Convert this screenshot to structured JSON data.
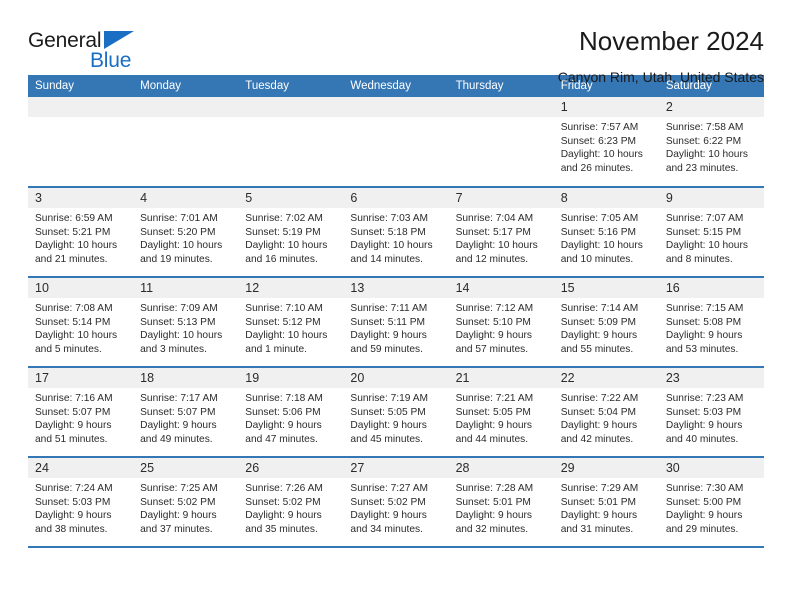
{
  "brand": {
    "word_one": "General",
    "word_two": "Blue",
    "logo_icon": "triangle-logo-icon",
    "accent_color": "#1a6fc4"
  },
  "header": {
    "title": "November 2024",
    "location": "Canyon Rim, Utah, United States"
  },
  "calendar": {
    "header_bg": "#3576b5",
    "daynum_bg": "#f0f0f0",
    "weekday_headers": [
      "Sunday",
      "Monday",
      "Tuesday",
      "Wednesday",
      "Thursday",
      "Friday",
      "Saturday"
    ],
    "labels": {
      "sunrise": "Sunrise:",
      "sunset": "Sunset:",
      "daylight": "Daylight:"
    },
    "weeks": [
      [
        {
          "day": "",
          "empty": true
        },
        {
          "day": "",
          "empty": true
        },
        {
          "day": "",
          "empty": true
        },
        {
          "day": "",
          "empty": true
        },
        {
          "day": "",
          "empty": true
        },
        {
          "day": "1",
          "sunrise": "Sunrise: 7:57 AM",
          "sunset": "Sunset: 6:23 PM",
          "daylight_line1": "Daylight: 10 hours",
          "daylight_line2": "and 26 minutes."
        },
        {
          "day": "2",
          "sunrise": "Sunrise: 7:58 AM",
          "sunset": "Sunset: 6:22 PM",
          "daylight_line1": "Daylight: 10 hours",
          "daylight_line2": "and 23 minutes."
        }
      ],
      [
        {
          "day": "3",
          "sunrise": "Sunrise: 6:59 AM",
          "sunset": "Sunset: 5:21 PM",
          "daylight_line1": "Daylight: 10 hours",
          "daylight_line2": "and 21 minutes."
        },
        {
          "day": "4",
          "sunrise": "Sunrise: 7:01 AM",
          "sunset": "Sunset: 5:20 PM",
          "daylight_line1": "Daylight: 10 hours",
          "daylight_line2": "and 19 minutes."
        },
        {
          "day": "5",
          "sunrise": "Sunrise: 7:02 AM",
          "sunset": "Sunset: 5:19 PM",
          "daylight_line1": "Daylight: 10 hours",
          "daylight_line2": "and 16 minutes."
        },
        {
          "day": "6",
          "sunrise": "Sunrise: 7:03 AM",
          "sunset": "Sunset: 5:18 PM",
          "daylight_line1": "Daylight: 10 hours",
          "daylight_line2": "and 14 minutes."
        },
        {
          "day": "7",
          "sunrise": "Sunrise: 7:04 AM",
          "sunset": "Sunset: 5:17 PM",
          "daylight_line1": "Daylight: 10 hours",
          "daylight_line2": "and 12 minutes."
        },
        {
          "day": "8",
          "sunrise": "Sunrise: 7:05 AM",
          "sunset": "Sunset: 5:16 PM",
          "daylight_line1": "Daylight: 10 hours",
          "daylight_line2": "and 10 minutes."
        },
        {
          "day": "9",
          "sunrise": "Sunrise: 7:07 AM",
          "sunset": "Sunset: 5:15 PM",
          "daylight_line1": "Daylight: 10 hours",
          "daylight_line2": "and 8 minutes."
        }
      ],
      [
        {
          "day": "10",
          "sunrise": "Sunrise: 7:08 AM",
          "sunset": "Sunset: 5:14 PM",
          "daylight_line1": "Daylight: 10 hours",
          "daylight_line2": "and 5 minutes."
        },
        {
          "day": "11",
          "sunrise": "Sunrise: 7:09 AM",
          "sunset": "Sunset: 5:13 PM",
          "daylight_line1": "Daylight: 10 hours",
          "daylight_line2": "and 3 minutes."
        },
        {
          "day": "12",
          "sunrise": "Sunrise: 7:10 AM",
          "sunset": "Sunset: 5:12 PM",
          "daylight_line1": "Daylight: 10 hours",
          "daylight_line2": "and 1 minute."
        },
        {
          "day": "13",
          "sunrise": "Sunrise: 7:11 AM",
          "sunset": "Sunset: 5:11 PM",
          "daylight_line1": "Daylight: 9 hours",
          "daylight_line2": "and 59 minutes."
        },
        {
          "day": "14",
          "sunrise": "Sunrise: 7:12 AM",
          "sunset": "Sunset: 5:10 PM",
          "daylight_line1": "Daylight: 9 hours",
          "daylight_line2": "and 57 minutes."
        },
        {
          "day": "15",
          "sunrise": "Sunrise: 7:14 AM",
          "sunset": "Sunset: 5:09 PM",
          "daylight_line1": "Daylight: 9 hours",
          "daylight_line2": "and 55 minutes."
        },
        {
          "day": "16",
          "sunrise": "Sunrise: 7:15 AM",
          "sunset": "Sunset: 5:08 PM",
          "daylight_line1": "Daylight: 9 hours",
          "daylight_line2": "and 53 minutes."
        }
      ],
      [
        {
          "day": "17",
          "sunrise": "Sunrise: 7:16 AM",
          "sunset": "Sunset: 5:07 PM",
          "daylight_line1": "Daylight: 9 hours",
          "daylight_line2": "and 51 minutes."
        },
        {
          "day": "18",
          "sunrise": "Sunrise: 7:17 AM",
          "sunset": "Sunset: 5:07 PM",
          "daylight_line1": "Daylight: 9 hours",
          "daylight_line2": "and 49 minutes."
        },
        {
          "day": "19",
          "sunrise": "Sunrise: 7:18 AM",
          "sunset": "Sunset: 5:06 PM",
          "daylight_line1": "Daylight: 9 hours",
          "daylight_line2": "and 47 minutes."
        },
        {
          "day": "20",
          "sunrise": "Sunrise: 7:19 AM",
          "sunset": "Sunset: 5:05 PM",
          "daylight_line1": "Daylight: 9 hours",
          "daylight_line2": "and 45 minutes."
        },
        {
          "day": "21",
          "sunrise": "Sunrise: 7:21 AM",
          "sunset": "Sunset: 5:05 PM",
          "daylight_line1": "Daylight: 9 hours",
          "daylight_line2": "and 44 minutes."
        },
        {
          "day": "22",
          "sunrise": "Sunrise: 7:22 AM",
          "sunset": "Sunset: 5:04 PM",
          "daylight_line1": "Daylight: 9 hours",
          "daylight_line2": "and 42 minutes."
        },
        {
          "day": "23",
          "sunrise": "Sunrise: 7:23 AM",
          "sunset": "Sunset: 5:03 PM",
          "daylight_line1": "Daylight: 9 hours",
          "daylight_line2": "and 40 minutes."
        }
      ],
      [
        {
          "day": "24",
          "sunrise": "Sunrise: 7:24 AM",
          "sunset": "Sunset: 5:03 PM",
          "daylight_line1": "Daylight: 9 hours",
          "daylight_line2": "and 38 minutes."
        },
        {
          "day": "25",
          "sunrise": "Sunrise: 7:25 AM",
          "sunset": "Sunset: 5:02 PM",
          "daylight_line1": "Daylight: 9 hours",
          "daylight_line2": "and 37 minutes."
        },
        {
          "day": "26",
          "sunrise": "Sunrise: 7:26 AM",
          "sunset": "Sunset: 5:02 PM",
          "daylight_line1": "Daylight: 9 hours",
          "daylight_line2": "and 35 minutes."
        },
        {
          "day": "27",
          "sunrise": "Sunrise: 7:27 AM",
          "sunset": "Sunset: 5:02 PM",
          "daylight_line1": "Daylight: 9 hours",
          "daylight_line2": "and 34 minutes."
        },
        {
          "day": "28",
          "sunrise": "Sunrise: 7:28 AM",
          "sunset": "Sunset: 5:01 PM",
          "daylight_line1": "Daylight: 9 hours",
          "daylight_line2": "and 32 minutes."
        },
        {
          "day": "29",
          "sunrise": "Sunrise: 7:29 AM",
          "sunset": "Sunset: 5:01 PM",
          "daylight_line1": "Daylight: 9 hours",
          "daylight_line2": "and 31 minutes."
        },
        {
          "day": "30",
          "sunrise": "Sunrise: 7:30 AM",
          "sunset": "Sunset: 5:00 PM",
          "daylight_line1": "Daylight: 9 hours",
          "daylight_line2": "and 29 minutes."
        }
      ]
    ]
  }
}
